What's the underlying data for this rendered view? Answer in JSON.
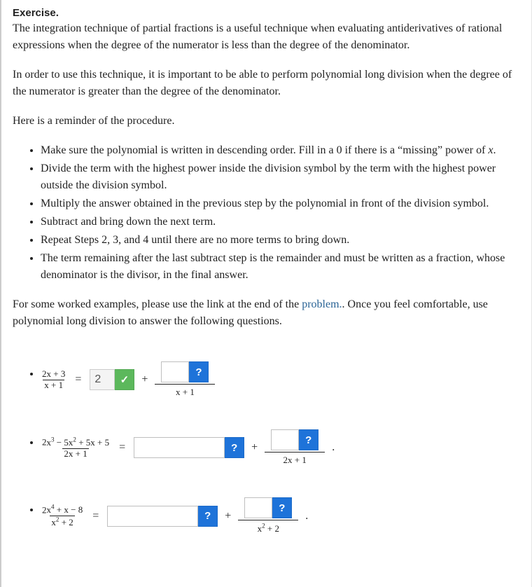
{
  "header": {
    "label": "Exercise."
  },
  "intro": {
    "p1": "The integration technique of partial fractions is a useful technique when evaluating antiderivatives of rational expressions when the degree of the numerator is less than the degree of the denominator.",
    "p2": "In order to use this technique, it is important to be able to perform polynomial long division when the degree of the numerator is greater than the degree of the denominator.",
    "p3": "Here is a reminder of the procedure."
  },
  "steps": {
    "s1a": "Make sure the polynomial is written in descending order. Fill in a 0 if there is a “missing” power of ",
    "s1var": "x",
    "s1b": ".",
    "s2": "Divide the term with the highest power inside the division symbol by the term with the highest power outside the division symbol.",
    "s3": "Multiply the answer obtained in the previous step by the polynomial in front of the division symbol.",
    "s4": "Subtract and bring down the next term.",
    "s5": "Repeat Steps 2, 3, and 4 until there are no more terms to bring down.",
    "s6": "The term remaining after the last subtract step is the remainder and must be written as a fraction, whose denominator is the divisor, in the final answer."
  },
  "outro": {
    "a": "For some worked examples, please use the link at the end of the ",
    "link": "problem.",
    "b": ". Once you feel comfortable, use polynomial long division to answer the following questions."
  },
  "symbols": {
    "eq": "=",
    "plus": "+",
    "period": ".",
    "hint": "?"
  },
  "icons": {
    "check": "✓"
  },
  "problems": {
    "q1": {
      "num": "2x + 3",
      "den": "x + 1",
      "quotient_value": "2",
      "remainder_den": "x + 1"
    },
    "q2": {
      "num": "2x³ − 5x² + 5x + 5",
      "den": "2x + 1",
      "remainder_den": "2x + 1"
    },
    "q3": {
      "num": "2x⁴ + x − 8",
      "den": "x² + 2",
      "remainder_den": "x² + 2"
    }
  }
}
